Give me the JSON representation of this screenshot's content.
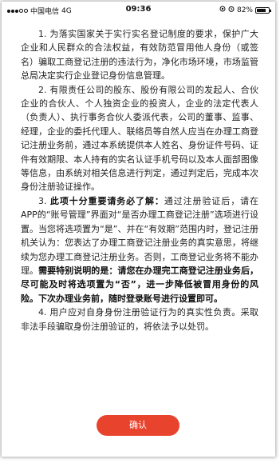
{
  "status_bar": {
    "carrier": "中国电信",
    "network": "4G",
    "time": "09:36",
    "battery_text": "82%",
    "battery_level": 0.82
  },
  "notice": {
    "p1": "1. 为落实国家关于实行实名登记制度的要求，保护广大企业和人民群众的合法权益，有效防范冒用他人身份（或签名）骗取工商登记注册的违法行为，净化市场环境，市场监管总局决定实行企业登记身份信息管理。",
    "p2": "2. 有限责任公司的股东、股份有限公司的发起人、合伙企业的合伙人、个人独资企业的投资人，企业的法定代表人（负责人）、执行事务合伙人委派代表，公司的董事、监事、经理，企业的委托代理人、联络员等自然人应当在办理工商登记注册业务前，通过本系统提供本人姓名、身份证件号码、证件有效期限、本人持有的实名认证手机号码以及本人面部图像等信息，由系统对相关信息进行判定，通过判定后，完成本次身份注册验证操作。",
    "p3_a": "3. ",
    "p3_b": "此项十分重要请务必了解：",
    "p3_c": "通过注册验证后，请在APP的“账号管理”界面对“是否办理工商登记注册”选项进行设置。当您将选项置为“是”、并在“有效期”范围内时，登记注册机关认为：您表达了办理工商登记注册业务的真实意思，将继续为您办理工商登记注册业务。否则，工商登记业务将不能办理。",
    "p3_d": "需要特别说明的是：请您在办理完工商登记注册业务后，尽可能及时将选项置为“否”，进一步降低被冒用身份的风险。下次办理业务前，随时登录账号进行设置即可。",
    "p4": "4. 用户应对自身身份注册验证行为的真实性负责。采取非法手段骗取身份注册验证的，将依法予以处罚。"
  },
  "confirm_label": "确认"
}
